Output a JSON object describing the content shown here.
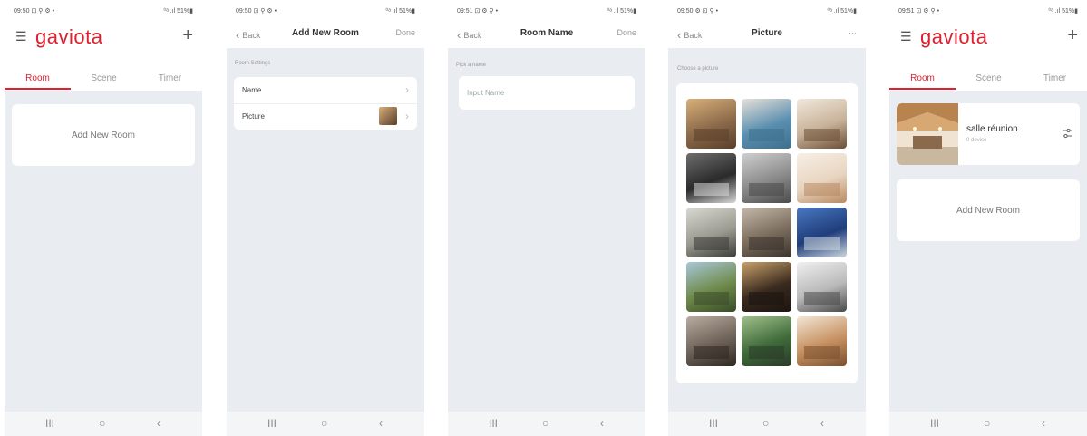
{
  "screen1": {
    "status_time": "09:50 ⊡ ⚲ ⚙ •",
    "status_sys": "⁰ᵃ .ıl 51%▮",
    "logo": "gaviota",
    "tabs": [
      "Room",
      "Scene",
      "Timer"
    ],
    "add_room_label": "Add New Room"
  },
  "screen2": {
    "status_time": "09:50 ⊡ ⚲ ⚙ •",
    "status_sys": "⁰ᵃ .ıl 51%▮",
    "back_label": "Back",
    "title": "Add New Room",
    "done_label": "Done",
    "section_label": "Room Settings",
    "rows": [
      "Name",
      "Picture"
    ]
  },
  "screen3": {
    "status_time": "09:51 ⊡ ⚙ ⚲ •",
    "status_sys": "⁰ᵃ .ıl 51%▮",
    "back_label": "Back",
    "title": "Room Name",
    "done_label": "Done",
    "section_label": "Pick a name",
    "input_placeholder": "Input Name"
  },
  "screen4": {
    "status_time": "09:50 ⚙ ⊡ ⚲ •",
    "status_sys": "⁰ᵃ .ıl 51%▮",
    "back_label": "Back",
    "title": "Picture",
    "more_label": "···",
    "section_label": "Choose a picture",
    "pictures": [
      {
        "name": "living-room-warm",
        "colors": [
          "#8b6a4a",
          "#d9b07a",
          "#5a3f2a"
        ]
      },
      {
        "name": "dining-blue-shelves",
        "colors": [
          "#5b8fb0",
          "#e6e1d8",
          "#3d6f8c"
        ]
      },
      {
        "name": "bedroom-wood",
        "colors": [
          "#c7b299",
          "#f2e8dc",
          "#6b4e35"
        ]
      },
      {
        "name": "dark-bedroom",
        "colors": [
          "#2a2a2a",
          "#6e6e6e",
          "#d8d8d8"
        ]
      },
      {
        "name": "grey-bedroom",
        "colors": [
          "#8a8a8a",
          "#cfcfcf",
          "#4a4a4a"
        ]
      },
      {
        "name": "kids-room",
        "colors": [
          "#e8d5c0",
          "#f7efe6",
          "#b88a63"
        ]
      },
      {
        "name": "open-kitchen",
        "colors": [
          "#9a9a90",
          "#d9d9d3",
          "#3b3b38"
        ]
      },
      {
        "name": "modern-bathroom",
        "colors": [
          "#7a6b5c",
          "#c4b8aa",
          "#3a332d"
        ]
      },
      {
        "name": "night-house",
        "colors": [
          "#1f3d7a",
          "#4a78c2",
          "#d0d8e0"
        ]
      },
      {
        "name": "lake-view",
        "colors": [
          "#6e8a4a",
          "#a8c7d8",
          "#3a4a2a"
        ]
      },
      {
        "name": "media-room",
        "colors": [
          "#3a2a1f",
          "#c9a26a",
          "#1a1410"
        ]
      },
      {
        "name": "mezzanine",
        "colors": [
          "#b9b9b9",
          "#f0f0f0",
          "#4a4a4a"
        ]
      },
      {
        "name": "outdoor-fireplace",
        "colors": [
          "#6e6258",
          "#b8aca0",
          "#2e2822"
        ]
      },
      {
        "name": "garden-house",
        "colors": [
          "#3f6a3a",
          "#9fc08a",
          "#2a3a28"
        ]
      },
      {
        "name": "wood-ceiling",
        "colors": [
          "#c69060",
          "#f3e6d6",
          "#7a5030"
        ]
      }
    ]
  },
  "screen5": {
    "status_time": "09:51 ⊡ ⚙ ⚲ •",
    "status_sys": "⁰ᵃ .ıl 51%▮",
    "logo": "gaviota",
    "tabs": [
      "Room",
      "Scene",
      "Timer"
    ],
    "room_name": "salle réunion",
    "room_devices": "0 device",
    "add_room_label": "Add New Room"
  },
  "navbar": {
    "recent": "III",
    "home": "○",
    "back": "‹"
  }
}
